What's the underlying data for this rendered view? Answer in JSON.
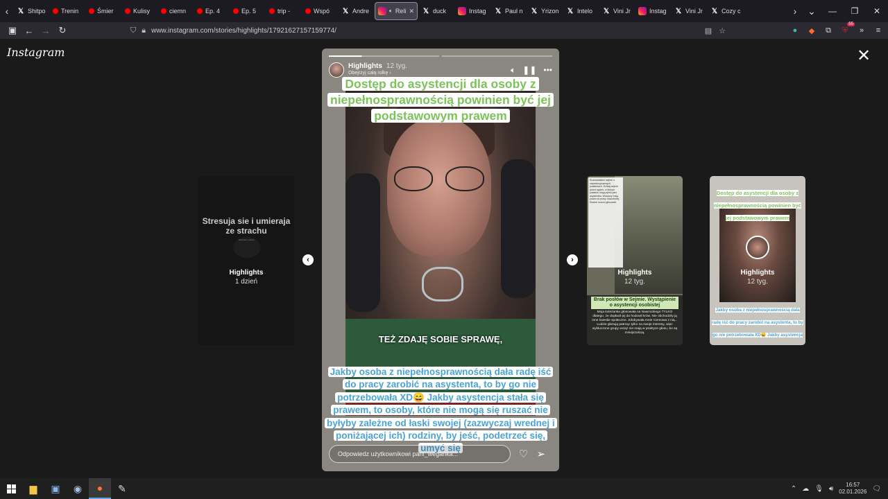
{
  "browser": {
    "tabs": [
      {
        "label": "Shitpo",
        "icon": "x-icon",
        "type": "x"
      },
      {
        "label": "Trenin",
        "icon": "youtube-icon",
        "type": "yt"
      },
      {
        "label": "Śmier",
        "icon": "youtube-icon",
        "type": "yt"
      },
      {
        "label": "Kulisy",
        "icon": "youtube-icon",
        "type": "yt"
      },
      {
        "label": "ciemn",
        "icon": "youtube-icon",
        "type": "yt"
      },
      {
        "label": "Ep. 4",
        "icon": "youtube-icon",
        "type": "yt"
      },
      {
        "label": "Ep. 5",
        "icon": "youtube-icon",
        "type": "yt"
      },
      {
        "label": "trip -",
        "icon": "youtube-icon",
        "type": "yt"
      },
      {
        "label": "Wspó",
        "icon": "youtube-icon",
        "type": "yt"
      },
      {
        "label": "Andre",
        "icon": "x-icon",
        "type": "x"
      },
      {
        "label": "Reli",
        "icon": "instagram-icon",
        "type": "ig",
        "active": true
      },
      {
        "label": "duck",
        "icon": "x-icon",
        "type": "x"
      },
      {
        "label": "Instag",
        "icon": "instagram-icon",
        "type": "ig"
      },
      {
        "label": "Paul n",
        "icon": "x-icon",
        "type": "x"
      },
      {
        "label": "Yrizon",
        "icon": "x-icon",
        "type": "x"
      },
      {
        "label": "Intelo",
        "icon": "x-icon",
        "type": "x"
      },
      {
        "label": "Vini Jr",
        "icon": "x-icon",
        "type": "x"
      },
      {
        "label": "Instag",
        "icon": "instagram-icon",
        "type": "ig"
      },
      {
        "label": "Vini Jr",
        "icon": "x-icon",
        "type": "x"
      },
      {
        "label": "Cozy c",
        "icon": "x-icon",
        "type": "x"
      }
    ],
    "url": "www.instagram.com/stories/highlights/17921627157159774/",
    "extension_badge": "55"
  },
  "instagram": {
    "logo": "Instagram",
    "story": {
      "name": "Highlights",
      "time": "12 tyg.",
      "sub": "Obejrzyj całą rolkę ›",
      "caption_top": "Dostęp do asystencji dla osoby z niepełnosprawnością powinien być jej podstawowym prawem",
      "subtitle": "TEŻ ZDAJĘ SOBIE SPRAWĘ,",
      "caption_bottom": "Jakby osoba z niepełnosprawnością dała radę iść do pracy zarobić na asystenta, to by go nie potrzebowała XD😄 Jakby asystencja stała się prawem, to osoby, które nie mogą się ruszać nie byłyby zależne od łaski swojej (zazwyczaj wrednej i poniżającej ich) rodziny, by jeść, podetrzeć się, umyć się",
      "reply_placeholder": "Odpowiedz użytkownikowi pani_weganka..."
    },
    "previews": {
      "left": {
        "title": "Stresuja sie i umieraja ze strachu",
        "small": "Jesli ktos z wami...",
        "name": "Highlights",
        "time": "1 dzień"
      },
      "middle": {
        "name": "Highlights",
        "time": "12 tyg.",
        "label": "Brak posłów w Sejmie. Wystąpienie o asystencji osobistej",
        "body": "Moja koleżanka głosowała na Nawrockiego TYLKO dlatego, że dopłacił jej do hodowli krów. Nie obchodziły ją inne kwestie społeczne. Zdobywała mnie rozmowa z nią... Ludzie głosują patrząc tylko na swoje interesy, więc wykluczone grupy wciąż nie mają w praktyce głosu, bo są mniejszością.",
        "textcol": "Rozmawiałem sejmie o niepełnosprawnych posłankach. Dzisiaj sejmie przed sądem, w którym posłanki mogą zjeść pani asystentka. Wszyscy mają prawo do pracy zawodowej. Razem mocno głosowali."
      },
      "right": {
        "name": "Highlights",
        "time": "12 tyg.",
        "top": "Dostęp do asystencji dla osoby z niepełnosprawnością powinien być jej podstawowym prawem",
        "bottom": "Jakby osoba z niepełnosprawnością dała radę iść do pracy zarobić na asystenta, to by go nie potrzebowała XD😄 Jakby asystencja stała się prawem, to osoby, które nie mogą się ruszać nie byłyby zależne od łaski swojej (zazwyczaj wrednej i poniżającej ich) rodziny, by jeść, podetrzeć się, umyć się."
      }
    },
    "colors": {
      "green_caption": "#7cc35a",
      "blue_caption": "#4aa3d6"
    }
  },
  "taskbar": {
    "time": "16:57",
    "date": "02.01.2026"
  }
}
